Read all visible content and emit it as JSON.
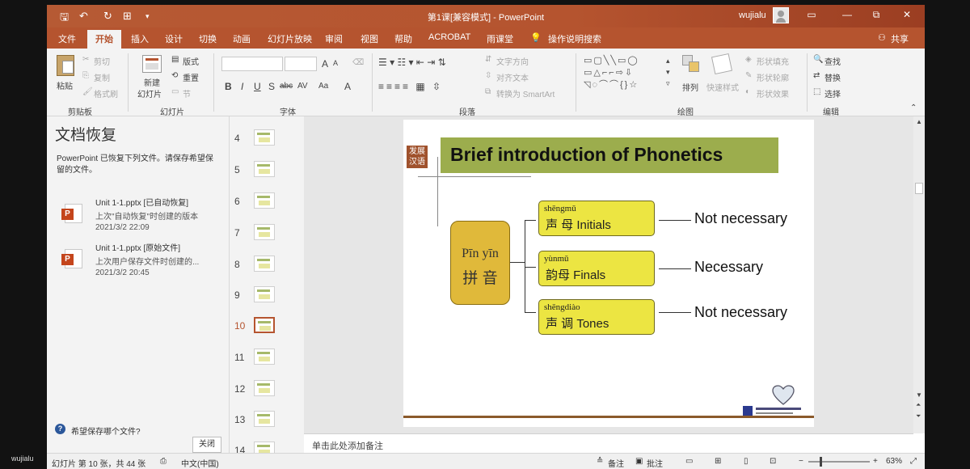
{
  "titlebar": {
    "title": "第1课[兼容模式] - PowerPoint",
    "user": "wujialu",
    "minimize": "—",
    "restore": "⧉",
    "close": "✕",
    "ribbon_display": "▭"
  },
  "tabs": [
    "文件",
    "开始",
    "插入",
    "设计",
    "切换",
    "动画",
    "幻灯片放映",
    "审阅",
    "视图",
    "帮助",
    "ACROBAT",
    "雨课堂"
  ],
  "active_tab": "开始",
  "tell_me": "操作说明搜索",
  "share": "共享",
  "ribbon": {
    "clipboard": {
      "paste": "粘贴",
      "cut": "剪切",
      "copy": "复制",
      "format_painter": "格式刷",
      "group": "剪贴板"
    },
    "slides": {
      "new_slide_1": "新建",
      "new_slide_2": "幻灯片",
      "layout": "版式",
      "reset": "重置",
      "section": "节",
      "group": "幻灯片"
    },
    "font": {
      "group": "字体",
      "bold": "B",
      "italic": "I",
      "underline": "U",
      "strike": "S",
      "shadow": "abc",
      "spacing": "AV",
      "case": "Aa",
      "color": "A",
      "grow": "A",
      "shrink": "A"
    },
    "paragraph": {
      "group": "段落",
      "text_direction": "文字方向",
      "align_text": "对齐文本",
      "smartart": "转换为 SmartArt"
    },
    "drawing": {
      "group": "绘图",
      "arrange": "排列",
      "quick_styles": "快速样式",
      "shape_fill": "形状填充",
      "shape_outline": "形状轮廓",
      "shape_effects": "形状效果"
    },
    "editing": {
      "group": "编辑",
      "find": "查找",
      "replace": "替换",
      "select": "选择"
    }
  },
  "recovery": {
    "heading": "文档恢复",
    "description": "PowerPoint 已恢复下列文件。请保存希望保留的文件。",
    "files": [
      {
        "name": "Unit 1-1.pptx  [已自动恢复]",
        "subtitle": "上次\"自动恢复\"时创建的版本",
        "date": "2021/3/2 22:09"
      },
      {
        "name": "Unit 1-1.pptx  [原始文件]",
        "subtitle": "上次用户保存文件时创建的...",
        "date": "2021/3/2 20:45"
      }
    ],
    "question": "希望保存哪个文件?",
    "close": "关闭"
  },
  "thumbnails": [
    "4",
    "5",
    "6",
    "7",
    "8",
    "9",
    "10",
    "11",
    "12",
    "13",
    "14"
  ],
  "active_slide": "10",
  "slide": {
    "badge": "发展汉语",
    "title": "Brief introduction of Phonetics",
    "pinyin": {
      "roman": "Pīn yīn",
      "hanzi": "拼 音"
    },
    "boxes": [
      {
        "py": "shēngmǔ",
        "hz": "声  母  Initials",
        "result": "Not necessary"
      },
      {
        "py": "yùnmǔ",
        "hz": "韵母  Finals",
        "result": "Necessary"
      },
      {
        "py": "shēngdiào",
        "hz": "声    调   Tones",
        "result": "Not necessary"
      }
    ]
  },
  "notes_placeholder": "单击此处添加备注",
  "status": {
    "slide_info": "幻灯片 第 10 张，共 44 张",
    "language": "中文(中国)",
    "notes": "备注",
    "comments": "批注",
    "zoom": "63%"
  },
  "outer_label": "wujialu"
}
